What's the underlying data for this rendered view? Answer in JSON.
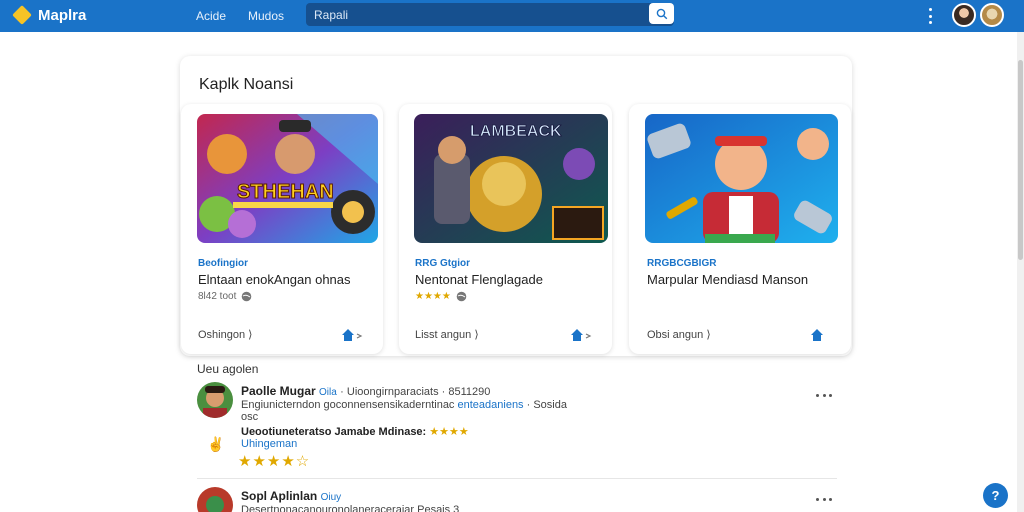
{
  "header": {
    "logo_text": "Maplra",
    "nav": [
      "Acide",
      "Mudos"
    ],
    "search_placeholder": "Rapali"
  },
  "section": {
    "title": "Kaplk Noansi"
  },
  "cards": [
    {
      "banner_text": "STHEHAN",
      "tag": "Beofingior",
      "title": "Elntaan enokAngan ohnas",
      "meta": "8l42 toot",
      "action": "Oshingon ⟩"
    },
    {
      "banner_text": "LAMBEACK",
      "tag": "RRG Gtgior",
      "title": "Nentonat Flenglagade",
      "meta": "★★★★",
      "action": "Lisst angun ⟩"
    },
    {
      "banner_text": "",
      "tag": "RRGBCGBIGR",
      "title": "Marpular Mendiasd Manson",
      "meta": "",
      "action": "Obsi angun ⟩"
    }
  ],
  "reviews": {
    "label": "Ueu agolen",
    "items": [
      {
        "name": "Paolle Mugar",
        "name_tag": "Oila",
        "line1_rest": "· Uioongirnparaciats · 8511290",
        "line2_a": "Engiunicterndon goconnensensikaderntinac",
        "line2_blue": "enteadaniens",
        "line2_b": "· Sosida",
        "line3": "osc",
        "line4_bold": "Ueootiuneteratso Jamabe Mdinase:",
        "line4_stars": "★★★★",
        "line5": "Uhingeman",
        "stars": "★★★★☆"
      },
      {
        "name": "Sopl Aplinlan",
        "name_tag": "Oiuy",
        "line1_rest": "Desertnonacanouronolaneraceraiar Pesais 3"
      }
    ]
  },
  "colors": {
    "brand": "#1a73c8",
    "star": "#e0a800",
    "logo": "#f6c326"
  }
}
